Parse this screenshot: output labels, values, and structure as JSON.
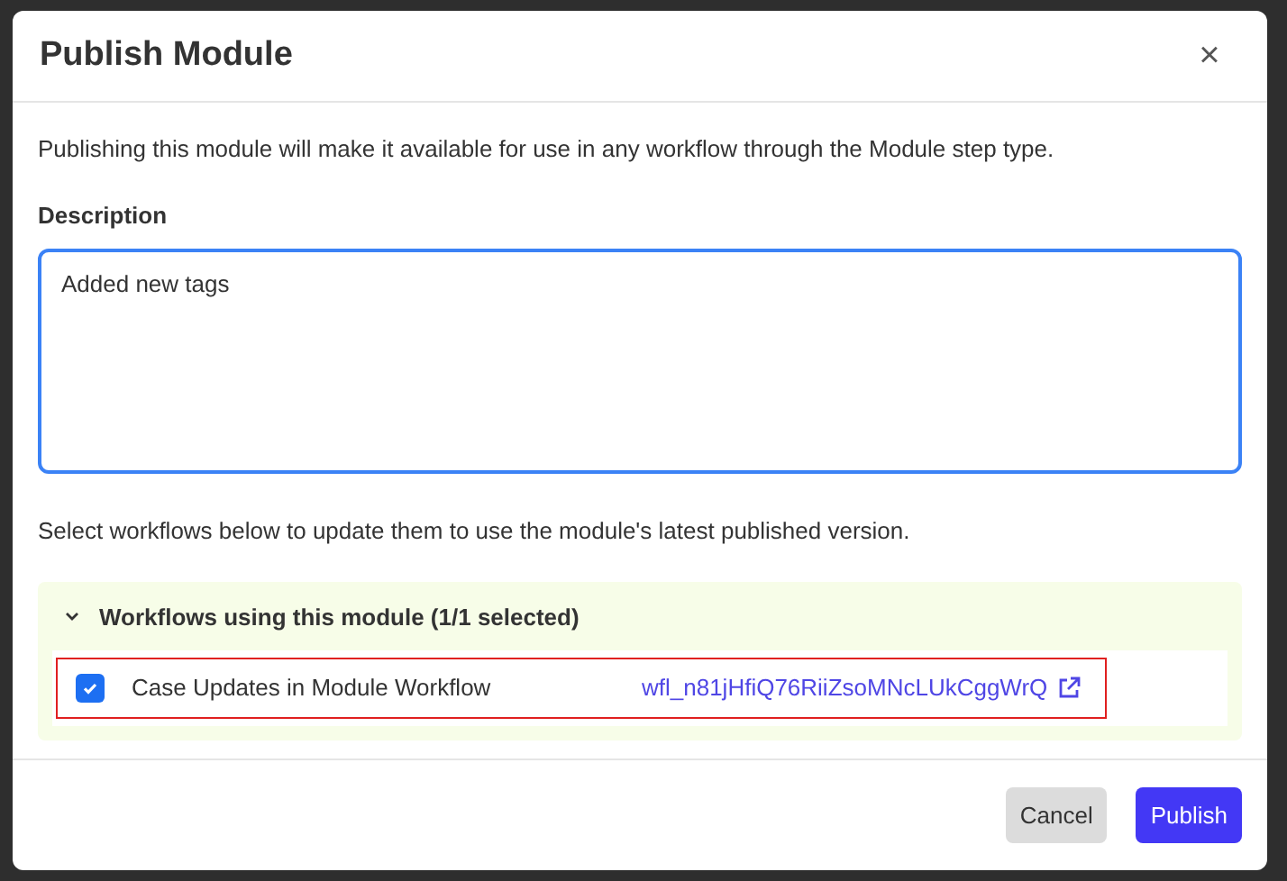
{
  "dialog": {
    "title": "Publish Module",
    "close": "×"
  },
  "intro": "Publishing this module will make it available for use in any workflow through the Module step type.",
  "description": {
    "label": "Description",
    "value": "Added new tags"
  },
  "instructions": "Select workflows below to update them to use the module's latest published version.",
  "workflows": {
    "heading": "Workflows using this module (1/1 selected)",
    "expanded": true,
    "items": [
      {
        "name": "Case Updates in Module Workflow",
        "id": "wfl_n81jHfiQ76RiiZsoMNcLUkCggWrQ",
        "checked": true,
        "highlighted": true
      }
    ]
  },
  "buttons": [
    {
      "label": "Cancel",
      "kind": "secondary"
    },
    {
      "label": "Publish",
      "kind": "primary"
    }
  ]
}
